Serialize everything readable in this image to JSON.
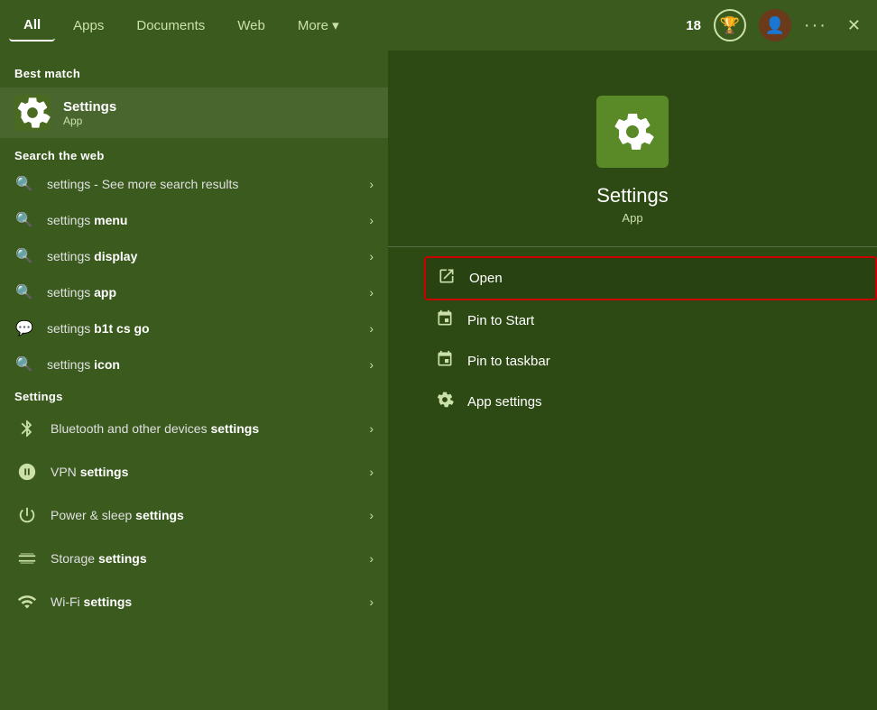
{
  "topBar": {
    "tabs": [
      {
        "label": "All",
        "active": true
      },
      {
        "label": "Apps",
        "active": false
      },
      {
        "label": "Documents",
        "active": false
      },
      {
        "label": "Web",
        "active": false
      },
      {
        "label": "More ▾",
        "active": false
      }
    ],
    "score": "18",
    "trophyIcon": "🏆",
    "avatarIcon": "👤",
    "ellipsis": "···",
    "closeIcon": "✕"
  },
  "leftPanel": {
    "bestMatchHeading": "Best match",
    "bestMatch": {
      "icon": "⚙",
      "title": "Settings",
      "subtitle": "App"
    },
    "searchWebHeading": "Search the web",
    "searchResults": [
      {
        "icon": "🔍",
        "prefix": "settings",
        "bold": "",
        "suffix": " - See more search results"
      },
      {
        "icon": "🔍",
        "prefix": "settings ",
        "bold": "menu",
        "suffix": ""
      },
      {
        "icon": "🔍",
        "prefix": "settings ",
        "bold": "display",
        "suffix": ""
      },
      {
        "icon": "🔍",
        "prefix": "settings ",
        "bold": "app",
        "suffix": ""
      },
      {
        "icon": "💬",
        "prefix": "settings ",
        "bold": "b1t cs go",
        "suffix": ""
      },
      {
        "icon": "🔍",
        "prefix": "settings ",
        "bold": "icon",
        "suffix": ""
      }
    ],
    "settingsHeading": "Settings",
    "settingsItems": [
      {
        "icon": "📶",
        "prefix": "Bluetooth and other devices ",
        "bold": "settings"
      },
      {
        "icon": "🔗",
        "prefix": "VPN ",
        "bold": "settings"
      },
      {
        "icon": "⏻",
        "prefix": "Power & sleep ",
        "bold": "settings"
      },
      {
        "icon": "💾",
        "prefix": "Storage ",
        "bold": "settings"
      },
      {
        "icon": "📡",
        "prefix": "Wi-Fi ",
        "bold": "settings"
      }
    ]
  },
  "rightPanel": {
    "appIcon": "⚙",
    "appName": "Settings",
    "appType": "App",
    "actions": [
      {
        "icon": "↗",
        "label": "Open",
        "highlighted": true
      },
      {
        "icon": "📌",
        "label": "Pin to Start",
        "highlighted": false
      },
      {
        "icon": "📌",
        "label": "Pin to taskbar",
        "highlighted": false
      },
      {
        "icon": "⚙",
        "label": "App settings",
        "highlighted": false
      }
    ]
  }
}
